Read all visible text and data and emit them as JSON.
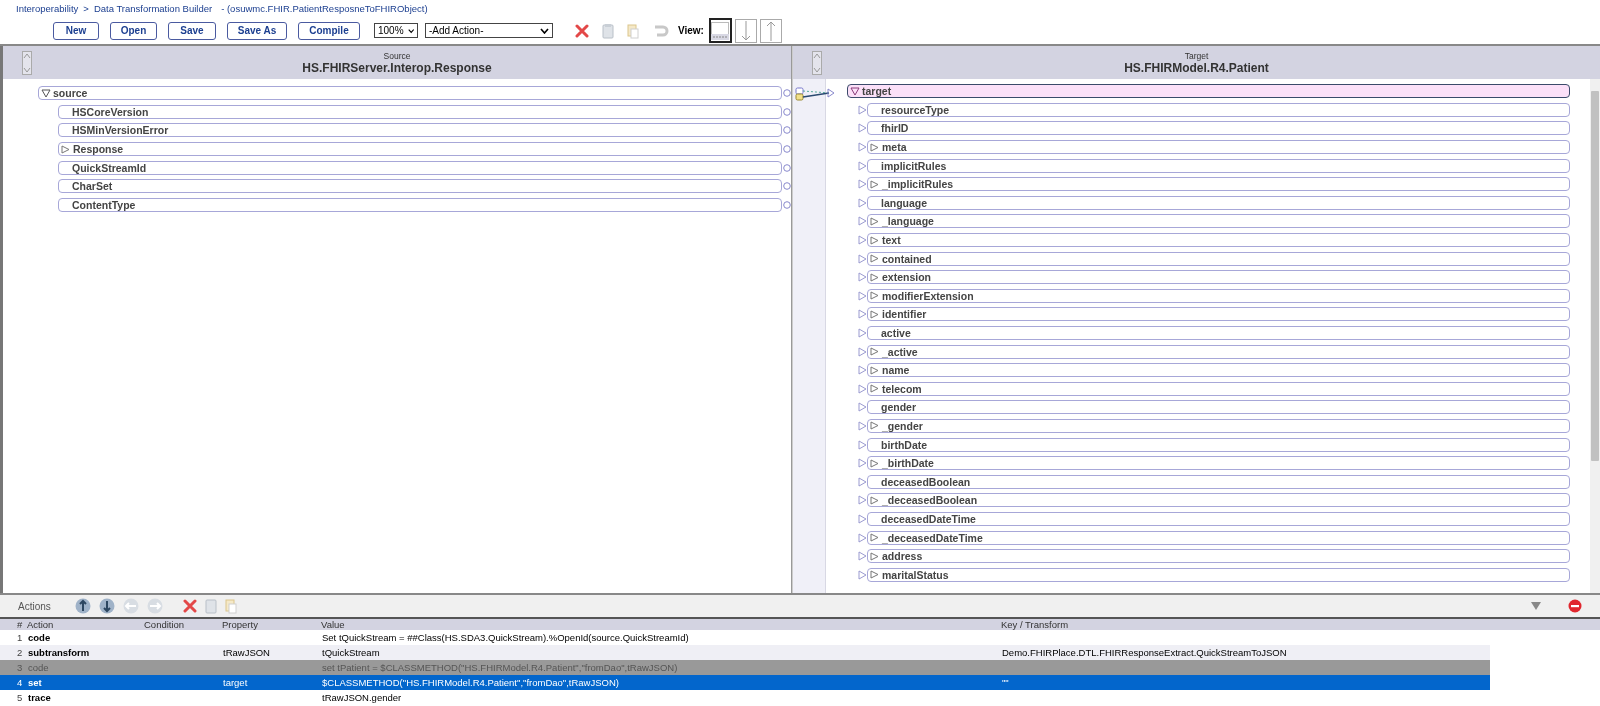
{
  "breadcrumb": {
    "items": [
      {
        "label": "Interoperability"
      },
      {
        "label": "Data Transformation Builder"
      }
    ],
    "separator": ">",
    "document": "- (osuwmc.FHIR.PatientResposneToFHIRObject)"
  },
  "toolbar": {
    "buttons": [
      "New",
      "Open",
      "Save",
      "Save As",
      "Compile"
    ],
    "zoom": "100%",
    "add_action": "-Add Action-",
    "view_label": "View:",
    "view_modes": [
      {
        "selected": true
      },
      {
        "selected": false
      },
      {
        "selected": false
      }
    ]
  },
  "source": {
    "caption": "Source",
    "title": "HS.FHIRServer.Interop.Response",
    "tree": {
      "label": "source",
      "expanded": true,
      "children": [
        {
          "label": "HSCoreVersion",
          "expandable": false
        },
        {
          "label": "HSMinVersionError",
          "expandable": false
        },
        {
          "label": "Response",
          "expandable": true
        },
        {
          "label": "QuickStreamId",
          "expandable": false
        },
        {
          "label": "CharSet",
          "expandable": false
        },
        {
          "label": "ContentType",
          "expandable": false
        }
      ]
    }
  },
  "target": {
    "caption": "Target",
    "title": "HS.FHIRModel.R4.Patient",
    "tree": {
      "label": "target",
      "expanded": true,
      "selected": true,
      "children": [
        {
          "label": "resourceType",
          "expandable": false
        },
        {
          "label": "fhirID",
          "expandable": false
        },
        {
          "label": "meta",
          "expandable": true
        },
        {
          "label": "implicitRules",
          "expandable": false
        },
        {
          "label": "_implicitRules",
          "expandable": true
        },
        {
          "label": "language",
          "expandable": false
        },
        {
          "label": "_language",
          "expandable": true
        },
        {
          "label": "text",
          "expandable": true
        },
        {
          "label": "contained",
          "expandable": true
        },
        {
          "label": "extension",
          "expandable": true
        },
        {
          "label": "modifierExtension",
          "expandable": true
        },
        {
          "label": "identifier",
          "expandable": true
        },
        {
          "label": "active",
          "expandable": false
        },
        {
          "label": "_active",
          "expandable": true
        },
        {
          "label": "name",
          "expandable": true
        },
        {
          "label": "telecom",
          "expandable": true
        },
        {
          "label": "gender",
          "expandable": false
        },
        {
          "label": "_gender",
          "expandable": true
        },
        {
          "label": "birthDate",
          "expandable": false
        },
        {
          "label": "_birthDate",
          "expandable": true
        },
        {
          "label": "deceasedBoolean",
          "expandable": false
        },
        {
          "label": "_deceasedBoolean",
          "expandable": true
        },
        {
          "label": "deceasedDateTime",
          "expandable": false
        },
        {
          "label": "_deceasedDateTime",
          "expandable": true
        },
        {
          "label": "address",
          "expandable": true
        },
        {
          "label": "maritalStatus",
          "expandable": true
        }
      ]
    }
  },
  "actions": {
    "label": "Actions",
    "columns": [
      "#",
      "Action",
      "Condition",
      "Property",
      "Value",
      "Key / Transform"
    ],
    "rows": [
      {
        "number": "1",
        "action": "code",
        "property": "",
        "value": "Set tQuickStream = ##Class(HS.SDA3.QuickStream).%OpenId(source.QuickStreamId)",
        "key": "",
        "disabled": false,
        "selected": false
      },
      {
        "number": "2",
        "action": "subtransform",
        "property": "tRawJSON",
        "value": "tQuickStream",
        "key": "Demo.FHIRPlace.DTL.FHIRResponseExtract.QuickStreamToJSON",
        "disabled": false,
        "selected": false
      },
      {
        "number": "3",
        "action": "code",
        "property": "",
        "value": "set tPatient = $CLASSMETHOD(\"HS.FHIRModel.R4.Patient\",\"fromDao\",tRawJSON)",
        "key": "",
        "disabled": true,
        "selected": false
      },
      {
        "number": "4",
        "action": "set",
        "property": "target",
        "value": "$CLASSMETHOD(\"HS.FHIRModel.R4.Patient\",\"fromDao\",tRawJSON)",
        "key": "\"\"",
        "disabled": false,
        "selected": true
      },
      {
        "number": "5",
        "action": "trace",
        "property": "",
        "value": "tRawJSON.gender",
        "key": "",
        "disabled": false,
        "selected": false
      }
    ]
  }
}
